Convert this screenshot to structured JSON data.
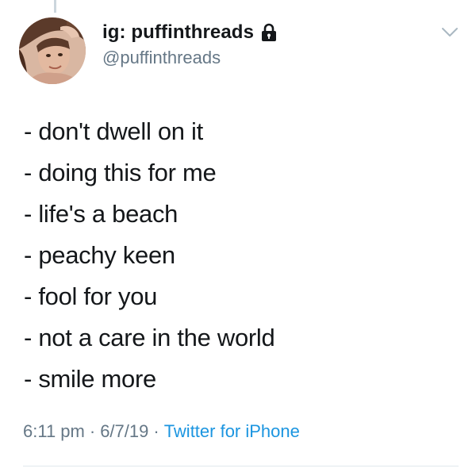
{
  "tweet": {
    "author": {
      "display_name": "ig: puffinthreads",
      "handle": "@puffinthreads",
      "protected_icon": "lock-icon",
      "avatar": "profile-photo"
    },
    "menu_icon": "chevron-down-icon",
    "lines": [
      "- don't dwell on it",
      "- doing this for me",
      "- life's a beach",
      "- peachy keen",
      "- fool for you",
      "- not a care in the world",
      "- smile more"
    ],
    "time": "6:11 pm",
    "separator": "·",
    "date": "6/7/19",
    "source": "Twitter for iPhone"
  },
  "colors": {
    "text": "#14171a",
    "secondary": "#657786",
    "link": "#1b95e0",
    "divider": "#e1e8ed"
  }
}
